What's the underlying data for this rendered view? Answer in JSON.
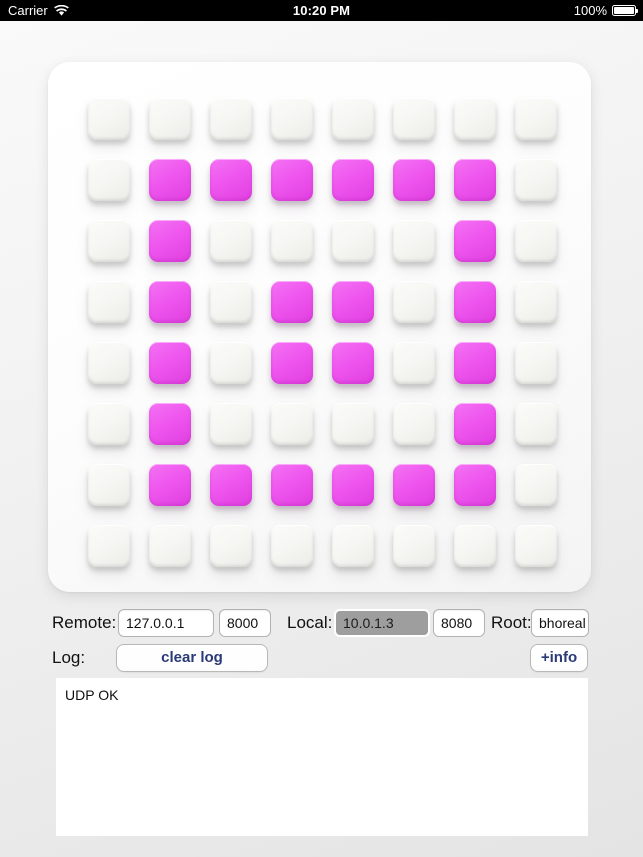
{
  "status_bar": {
    "carrier": "Carrier",
    "wifi_icon": "wifi-icon",
    "time": "10:20 PM",
    "battery_percent": "100%",
    "battery_icon": "battery-full-icon"
  },
  "pad_panel": {
    "rows": 8,
    "cols": 8,
    "on_color": "#EE55EE",
    "off_color": "#F6F6F3",
    "state": [
      [
        0,
        0,
        0,
        0,
        0,
        0,
        0,
        0
      ],
      [
        0,
        1,
        1,
        1,
        1,
        1,
        1,
        0
      ],
      [
        0,
        1,
        0,
        0,
        0,
        0,
        1,
        0
      ],
      [
        0,
        1,
        0,
        1,
        1,
        0,
        1,
        0
      ],
      [
        0,
        1,
        0,
        1,
        1,
        0,
        1,
        0
      ],
      [
        0,
        1,
        0,
        0,
        0,
        0,
        1,
        0
      ],
      [
        0,
        1,
        1,
        1,
        1,
        1,
        1,
        0
      ],
      [
        0,
        0,
        0,
        0,
        0,
        0,
        0,
        0
      ]
    ]
  },
  "network": {
    "remote_label": "Remote:",
    "remote_host": "127.0.0.1",
    "remote_host_placeholder": "127.0.0.1",
    "remote_port": "8000",
    "remote_port_placeholder": "8000",
    "local_label": "Local:",
    "local_host": "10.0.1.3",
    "local_host_placeholder": "10.0.1.3",
    "local_port": "8080",
    "local_port_placeholder": "8080",
    "root_label": "Root:",
    "root_value": "bhoreal",
    "root_placeholder": "bhoreal"
  },
  "log_section": {
    "label": "Log:",
    "clear_button": "clear log",
    "info_button": "+info",
    "content": "UDP OK"
  }
}
